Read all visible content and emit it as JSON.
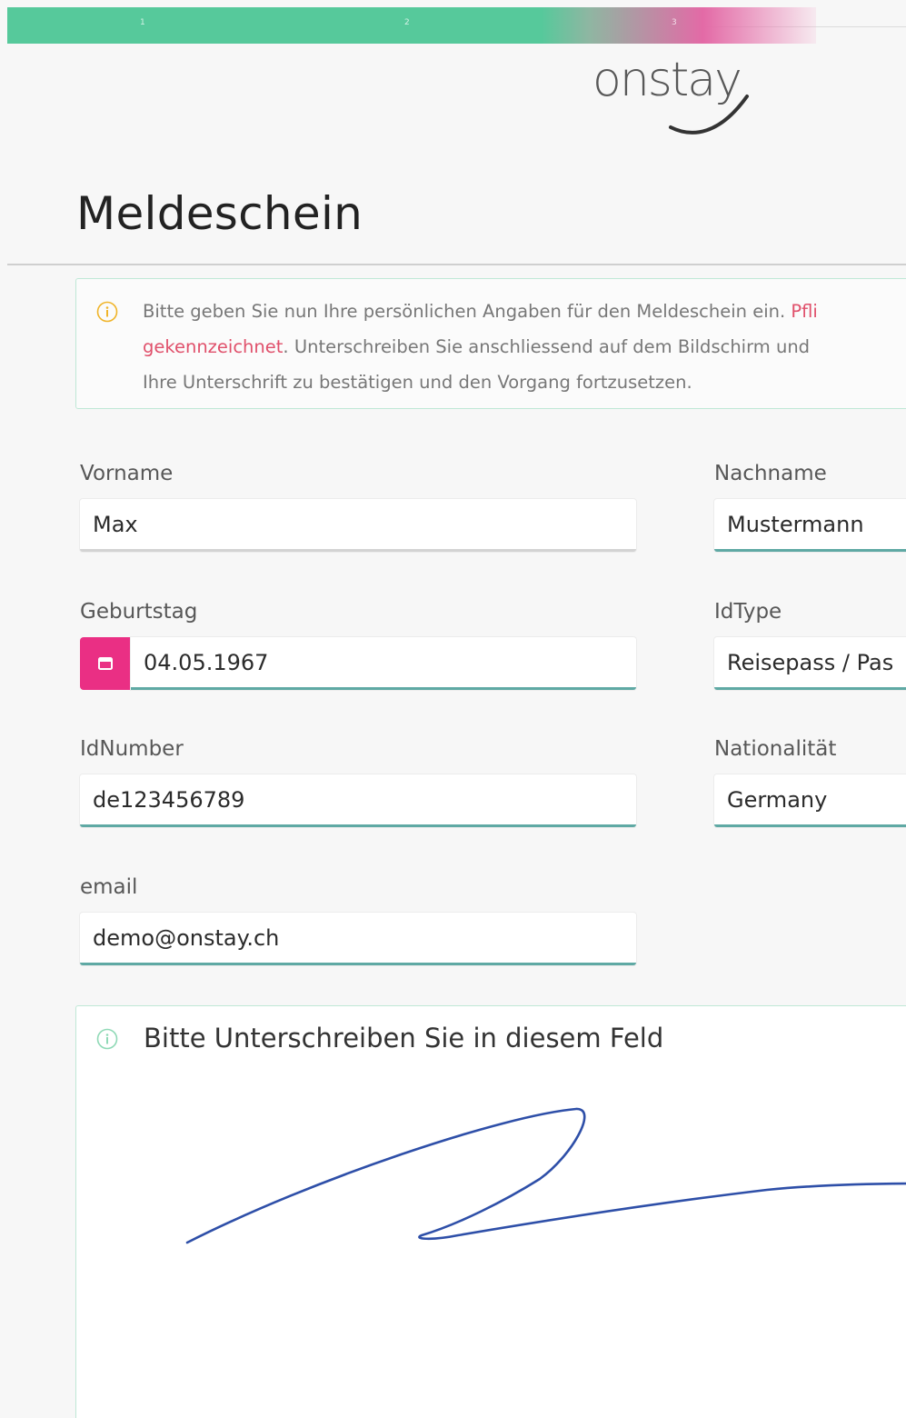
{
  "progress": {
    "steps": [
      "1",
      "2",
      "3"
    ],
    "fill_fraction": 0.9
  },
  "brand": {
    "logo_text": "onstay"
  },
  "title": "Meldeschein",
  "info": {
    "text_before": "Bitte geben Sie nun Ihre persönlichen Angaben für den Meldeschein ein. ",
    "required_part1": "Pfli",
    "required_part2": "gekennzeichnet",
    "text_middle": ". Unterschreiben Sie anschliessend auf dem Bildschirm und",
    "text_after": "Ihre Unterschrift zu bestätigen und den Vorgang fortzusetzen."
  },
  "form": {
    "first_name": {
      "label": "Vorname",
      "value": "Max"
    },
    "last_name": {
      "label": "Nachname",
      "value": "Mustermann"
    },
    "birthday": {
      "label": "Geburtstag",
      "value": "04.05.1967"
    },
    "id_type": {
      "label": "IdType",
      "value": "Reisepass / Pas"
    },
    "id_number": {
      "label": "IdNumber",
      "value": "de123456789"
    },
    "nationality": {
      "label": "Nationalität",
      "value": "Germany"
    },
    "email": {
      "label": "email",
      "value": "demo@onstay.ch"
    }
  },
  "signature": {
    "title": "Bitte Unterschreiben Sie in diesem Feld"
  },
  "icons": {
    "info": "info-circle-icon",
    "calendar": "calendar-icon"
  },
  "colors": {
    "accent_green": "#56c99b",
    "accent_pink": "#ea2f84",
    "input_underline": "#5fa9a4",
    "required_red": "#e0506b",
    "signature_ink": "#2e4fa8"
  }
}
